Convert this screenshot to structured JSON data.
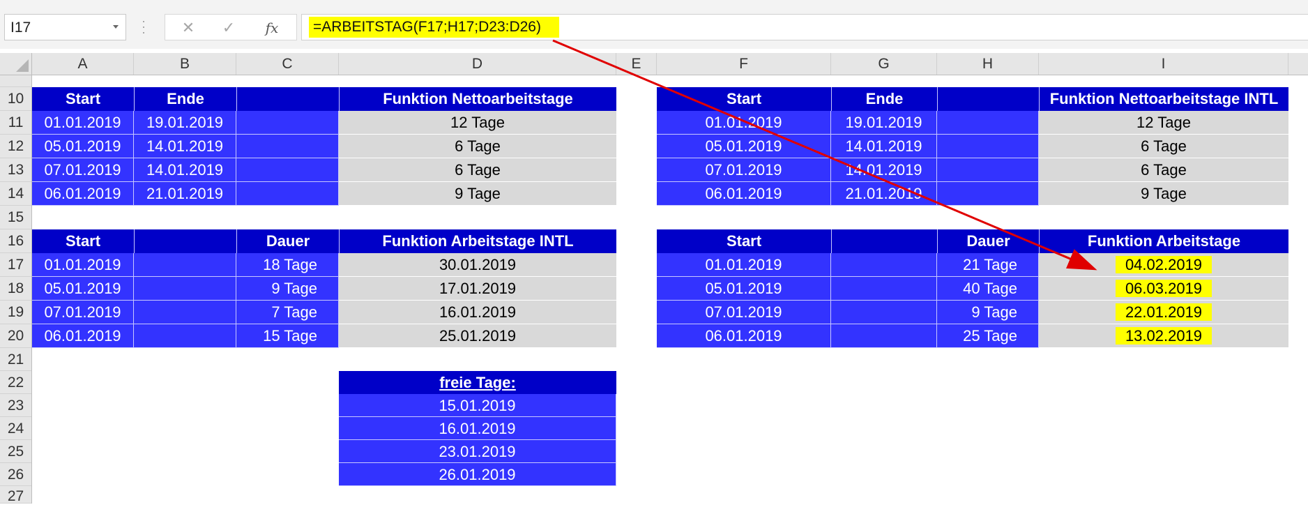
{
  "formula_bar": {
    "name_box": "I17",
    "cancel_icon": "✕",
    "enter_icon": "✓",
    "fx_label": "fx",
    "formula": "=ARBEITSTAG(F17;H17;D23:D26)"
  },
  "columns": [
    "A",
    "B",
    "C",
    "D",
    "E",
    "F",
    "G",
    "H",
    "I"
  ],
  "rows": [
    "10",
    "11",
    "12",
    "13",
    "14",
    "15",
    "16",
    "17",
    "18",
    "19",
    "20",
    "21",
    "22",
    "23",
    "24",
    "25",
    "26",
    "27"
  ],
  "table_netto": {
    "headers": {
      "start": "Start",
      "ende": "Ende",
      "func": "Funktion Nettoarbeitstage"
    },
    "rows": [
      {
        "start": "01.01.2019",
        "ende": "19.01.2019",
        "result": "12 Tage"
      },
      {
        "start": "05.01.2019",
        "ende": "14.01.2019",
        "result": "6 Tage"
      },
      {
        "start": "07.01.2019",
        "ende": "14.01.2019",
        "result": "6 Tage"
      },
      {
        "start": "06.01.2019",
        "ende": "21.01.2019",
        "result": "9 Tage"
      }
    ]
  },
  "table_netto_intl": {
    "headers": {
      "start": "Start",
      "ende": "Ende",
      "func": "Funktion Nettoarbeitstage INTL"
    },
    "rows": [
      {
        "start": "01.01.2019",
        "ende": "19.01.2019",
        "result": "12 Tage"
      },
      {
        "start": "05.01.2019",
        "ende": "14.01.2019",
        "result": "6 Tage"
      },
      {
        "start": "07.01.2019",
        "ende": "14.01.2019",
        "result": "6 Tage"
      },
      {
        "start": "06.01.2019",
        "ende": "21.01.2019",
        "result": "9 Tage"
      }
    ]
  },
  "table_arbeitstage_intl": {
    "headers": {
      "start": "Start",
      "dauer": "Dauer",
      "func": "Funktion Arbeitstage INTL"
    },
    "rows": [
      {
        "start": "01.01.2019",
        "dauer": "18 Tage",
        "result": "30.01.2019"
      },
      {
        "start": "05.01.2019",
        "dauer": "9 Tage",
        "result": "17.01.2019"
      },
      {
        "start": "07.01.2019",
        "dauer": "7 Tage",
        "result": "16.01.2019"
      },
      {
        "start": "06.01.2019",
        "dauer": "15 Tage",
        "result": "25.01.2019"
      }
    ]
  },
  "table_arbeitstage": {
    "headers": {
      "start": "Start",
      "dauer": "Dauer",
      "func": "Funktion Arbeitstage"
    },
    "rows": [
      {
        "start": "01.01.2019",
        "dauer": "21 Tage",
        "result": "04.02.2019"
      },
      {
        "start": "05.01.2019",
        "dauer": "40 Tage",
        "result": "06.03.2019"
      },
      {
        "start": "07.01.2019",
        "dauer": "9 Tage",
        "result": "22.01.2019"
      },
      {
        "start": "06.01.2019",
        "dauer": "25 Tage",
        "result": "13.02.2019"
      }
    ]
  },
  "free_days": {
    "header": "freie Tage:",
    "dates": [
      "15.01.2019",
      "16.01.2019",
      "23.01.2019",
      "26.01.2019"
    ]
  },
  "colors": {
    "header_blue": "#0000c8",
    "cell_blue": "#3333ff",
    "cell_gray": "#d9d9d9",
    "highlight": "#ffff00",
    "arrow": "#e00000"
  }
}
